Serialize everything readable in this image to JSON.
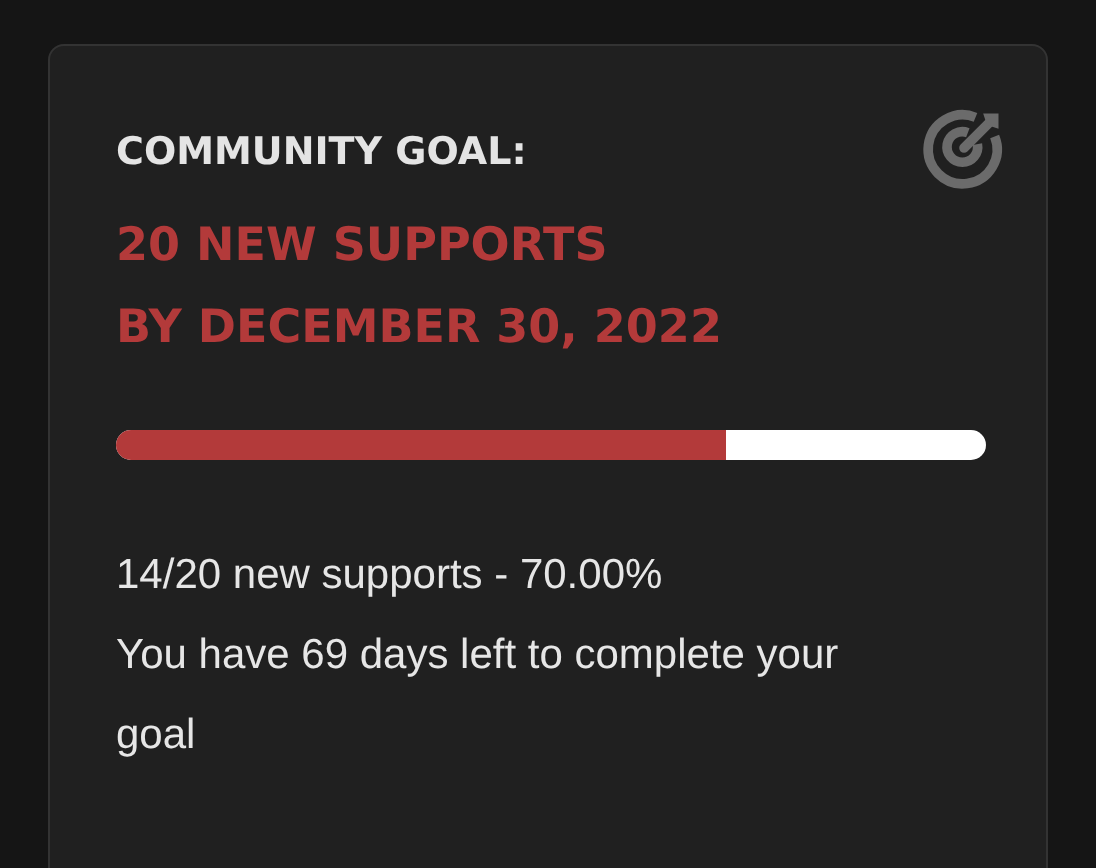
{
  "goal_card": {
    "heading": "COMMUNITY GOAL:",
    "goal_lines": [
      "20 NEW SUPPORTS",
      "BY DECEMBER 30, 2022"
    ],
    "progress": {
      "level": 0.7
    },
    "summary": "14/20 new supports - 70.00%",
    "remaining": "You have 69 days left to complete your goal"
  }
}
